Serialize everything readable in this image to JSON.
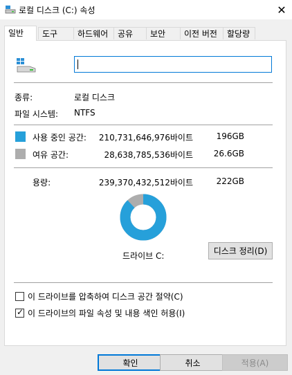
{
  "window": {
    "title": "로컬 디스크 (C:) 속성",
    "close_glyph": "✕"
  },
  "tabs": [
    {
      "label": "일반",
      "active": true
    },
    {
      "label": "도구",
      "active": false
    },
    {
      "label": "하드웨어",
      "active": false
    },
    {
      "label": "공유",
      "active": false
    },
    {
      "label": "보안",
      "active": false
    },
    {
      "label": "이전 버전",
      "active": false
    },
    {
      "label": "할당량",
      "active": false
    }
  ],
  "general": {
    "name_value": "",
    "type_label": "종류:",
    "type_value": "로컬 디스크",
    "fs_label": "파일 시스템:",
    "fs_value": "NTFS",
    "used": {
      "label": "사용 중인 공간:",
      "bytes": "210,731,646,976바이트",
      "size": "196GB",
      "color": "#26a0da"
    },
    "free": {
      "label": "여유 공간:",
      "bytes": "28,638,785,536바이트",
      "size": "26.6GB",
      "color": "#adadad"
    },
    "capacity": {
      "label": "용량:",
      "bytes": "239,370,432,512바이트",
      "size": "222GB"
    },
    "drive_label": "드라이브 C:",
    "cleanup_button": "디스크 정리(D)",
    "compress": {
      "label": "이 드라이브를 압축하여 디스크 공간 절약(C)",
      "checked": false
    },
    "index": {
      "label": "이 드라이브의 파일 속성 및 내용 색인 허용(I)",
      "checked": true
    },
    "used_fraction": 0.8804
  },
  "buttons": {
    "ok": "확인",
    "cancel": "취소",
    "apply": "적용(A)"
  },
  "icons": {
    "title": "drive-icon",
    "drive": "drive-icon",
    "close": "close-icon",
    "check": "check-icon"
  }
}
